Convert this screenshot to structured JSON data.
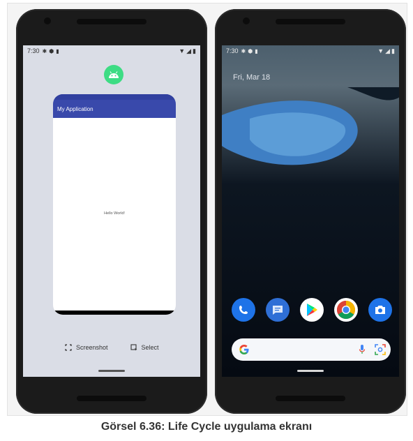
{
  "left_phone": {
    "status": {
      "time": "7:30"
    },
    "recents": {
      "app_title": "My Application",
      "content_text": "Hello World!",
      "screenshot_label": "Screenshot",
      "select_label": "Select"
    }
  },
  "right_phone": {
    "status": {
      "time": "7:30"
    },
    "date": "Fri, Mar 18",
    "dock": [
      "phone",
      "messages",
      "play-store",
      "chrome",
      "camera"
    ]
  },
  "caption": "Görsel 6.36: Life Cycle uygulama ekranı",
  "colors": {
    "app_bar": "#3949ab",
    "android_green": "#3ddc84",
    "recents_bg": "#dadde6"
  }
}
